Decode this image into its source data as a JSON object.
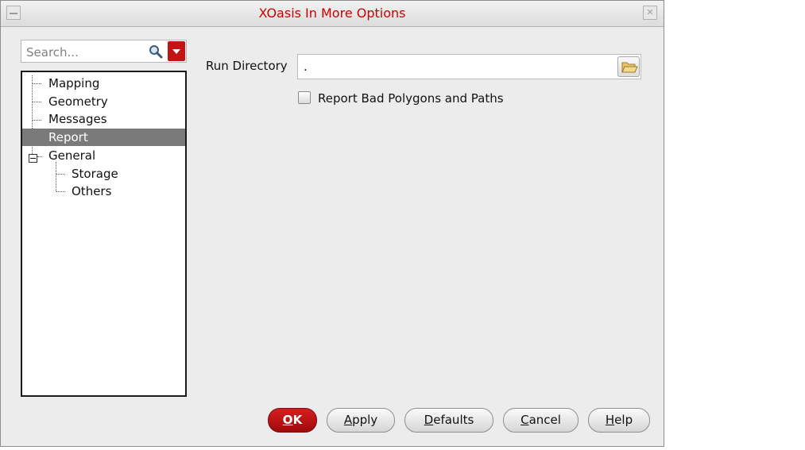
{
  "window": {
    "title": "XOasis In More Options"
  },
  "search": {
    "placeholder": "Search..."
  },
  "tree": {
    "items": [
      "Mapping",
      "Geometry",
      "Messages",
      "Report"
    ],
    "group": {
      "label": "General",
      "children": [
        "Storage",
        "Others"
      ]
    },
    "selected": "Report"
  },
  "run_directory": {
    "label": "Run Directory",
    "value": "."
  },
  "report_bad": {
    "label": "Report Bad Polygons and Paths",
    "checked": false
  },
  "buttons": {
    "ok": {
      "key": "O",
      "rest": "K"
    },
    "apply": {
      "key": "A",
      "rest": "pply"
    },
    "defaults": {
      "key": "D",
      "rest": "efaults"
    },
    "cancel": {
      "key": "C",
      "rest": "ancel"
    },
    "help": {
      "key": "H",
      "rest": "elp"
    }
  },
  "colors": {
    "title": "#cc0000",
    "accent": "#c21414",
    "selection": "#7a7a7a"
  }
}
